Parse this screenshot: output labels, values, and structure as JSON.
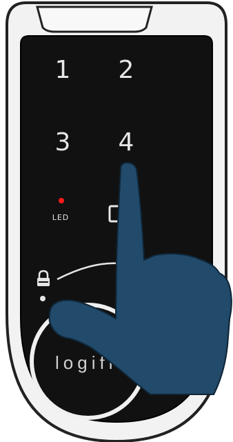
{
  "device": {
    "name": "",
    "keypad": {
      "keys": [
        {
          "label": "1"
        },
        {
          "label": "2"
        },
        {
          "label": "3"
        },
        {
          "label": "4"
        }
      ]
    },
    "led": {
      "label": "LED",
      "color": "#ff1a1a"
    },
    "brand": "logifl"
  },
  "colors": {
    "body_outline": "#222222",
    "body_fill": "#f2f2f2",
    "panel": "#111111",
    "hand": "#224a6a",
    "digits": "#e6e6e6"
  },
  "icons": {
    "lock": "lock-icon",
    "hand": "pointing-hand-icon",
    "key_square": "square-key-icon"
  }
}
